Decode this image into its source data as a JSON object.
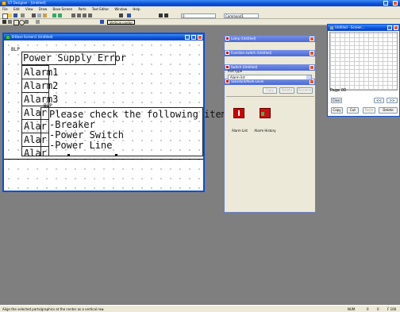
{
  "app": {
    "title": "GT Designer - [Untitled]",
    "menu": [
      "File",
      "Edit",
      "View",
      "Draw",
      "Base Screen",
      "Parts",
      "Text Editor",
      "Window",
      "Help"
    ],
    "tooltip": "Vertical center",
    "combo1_value": "0",
    "combo2_value": "Command1"
  },
  "screen_window": {
    "title": "B-Base Screen1 (Untitled)",
    "labels": {
      "ps": "Power Supply Error",
      "a1": "Alarm1",
      "a2": "Alarm2",
      "a3": "Alarm3",
      "a4": "Alar",
      "a5": "Alar",
      "a6": "Alar",
      "a7": "Alar",
      "please": "Please check the following items",
      "l1": "-Breaker",
      "l2": "-Power Switch",
      "l3": "-Power Line"
    },
    "tags": {
      "t1": "BLP",
      "t2": "BLP"
    }
  },
  "palettes": {
    "bars": [
      "Lamp (Untitled)",
      "Function switch (Untitled)",
      "Switch (Untitled)",
      "Standard/Multi-Level"
    ],
    "category_label": "Part type",
    "select_value": "Alarm list",
    "buttons": {
      "copy": "Copy",
      "delete": "Delete",
      "rename": "Rename"
    },
    "items": [
      "Alarm List",
      "Alarm History"
    ]
  },
  "right_window": {
    "title": "Untitled - Screen...",
    "page_label": "Page 00",
    "buttons": {
      "clear": "Clear",
      "copy": "Copy",
      "cut": "Cut",
      "paste": "Paste",
      "delete": "Delete"
    },
    "nav": {
      "prev": "<<",
      "next": ">>"
    }
  },
  "status_bar": {
    "hint": "Align the selected parts/graphics at the center as a vertical row.",
    "fields": [
      "NUM",
      "0",
      "0",
      "F 100"
    ]
  },
  "colors": {
    "desktop": "#7f7f7f",
    "titlebar": "#0a4fd6",
    "chrome": "#ece9d8",
    "alarm_icon": "#d00000",
    "history_icon": "#cc1010"
  }
}
